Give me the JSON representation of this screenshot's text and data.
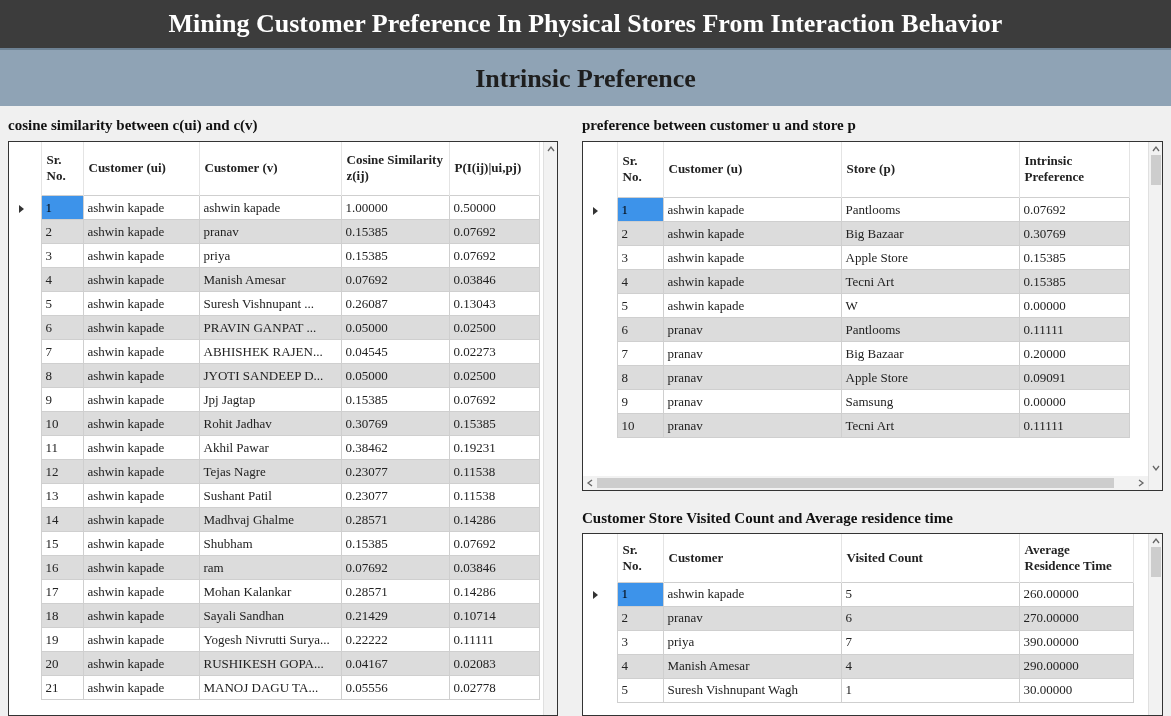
{
  "header": {
    "title": "Mining Customer Preference In Physical Stores From Interaction Behavior"
  },
  "section": {
    "title": "Intrinsic Preference"
  },
  "cosine_panel": {
    "heading": "cosine similarity between c(ui) and c(v)",
    "table": {
      "columns": [
        "Sr. No.",
        "Customer (ui)",
        "Customer (v)",
        "Cosine Similarity z(ij)",
        "P(I(ij)|ui,pj)"
      ],
      "rows": [
        {
          "cells": [
            "1",
            "ashwin kapade",
            "ashwin kapade",
            "1.00000",
            "0.50000"
          ],
          "selected": true
        },
        {
          "cells": [
            "2",
            "ashwin kapade",
            "pranav",
            "0.15385",
            "0.07692"
          ],
          "selected": false
        },
        {
          "cells": [
            "3",
            "ashwin kapade",
            "priya",
            "0.15385",
            "0.07692"
          ],
          "selected": false
        },
        {
          "cells": [
            "4",
            "ashwin kapade",
            "Manish Amesar",
            "0.07692",
            "0.03846"
          ],
          "selected": false
        },
        {
          "cells": [
            "5",
            "ashwin kapade",
            "Suresh Vishnupant  ...",
            "0.26087",
            "0.13043"
          ],
          "selected": false
        },
        {
          "cells": [
            "6",
            "ashwin kapade",
            "PRAVIN GANPAT ...",
            "0.05000",
            "0.02500"
          ],
          "selected": false
        },
        {
          "cells": [
            "7",
            "ashwin kapade",
            "ABHISHEK RAJEN...",
            "0.04545",
            "0.02273"
          ],
          "selected": false
        },
        {
          "cells": [
            "8",
            "ashwin kapade",
            "JYOTI SANDEEP D...",
            "0.05000",
            "0.02500"
          ],
          "selected": false
        },
        {
          "cells": [
            "9",
            "ashwin kapade",
            "Jpj  Jagtap",
            "0.15385",
            "0.07692"
          ],
          "selected": false
        },
        {
          "cells": [
            "10",
            "ashwin kapade",
            "Rohit Jadhav",
            "0.30769",
            "0.15385"
          ],
          "selected": false
        },
        {
          "cells": [
            "11",
            "ashwin kapade",
            "Akhil Pawar",
            "0.38462",
            "0.19231"
          ],
          "selected": false
        },
        {
          "cells": [
            "12",
            "ashwin kapade",
            "Tejas Nagre",
            "0.23077",
            "0.11538"
          ],
          "selected": false
        },
        {
          "cells": [
            "13",
            "ashwin kapade",
            "Sushant Patil",
            "0.23077",
            "0.11538"
          ],
          "selected": false
        },
        {
          "cells": [
            "14",
            "ashwin kapade",
            "Madhvaj Ghalme",
            "0.28571",
            "0.14286"
          ],
          "selected": false
        },
        {
          "cells": [
            "15",
            "ashwin kapade",
            "Shubham",
            "0.15385",
            "0.07692"
          ],
          "selected": false
        },
        {
          "cells": [
            "16",
            "ashwin kapade",
            "ram",
            "0.07692",
            "0.03846"
          ],
          "selected": false
        },
        {
          "cells": [
            "17",
            "ashwin kapade",
            "Mohan Kalankar",
            "0.28571",
            "0.14286"
          ],
          "selected": false
        },
        {
          "cells": [
            "18",
            "ashwin kapade",
            "Sayali Sandhan",
            "0.21429",
            "0.10714"
          ],
          "selected": false
        },
        {
          "cells": [
            "19",
            "ashwin kapade",
            "Yogesh Nivrutti Surya...",
            "0.22222",
            "0.11111"
          ],
          "selected": false
        },
        {
          "cells": [
            "20",
            "ashwin kapade",
            "RUSHIKESH GOPA...",
            "0.04167",
            "0.02083"
          ],
          "selected": false
        },
        {
          "cells": [
            "21",
            "ashwin kapade",
            "MANOJ DAGU TA...",
            "0.05556",
            "0.02778"
          ],
          "selected": false
        }
      ]
    }
  },
  "preference_panel": {
    "heading": "preference between customer u and store p",
    "table": {
      "columns": [
        "Sr. No.",
        "Customer (u)",
        "Store (p)",
        "Intrinsic Preference"
      ],
      "rows": [
        {
          "cells": [
            "1",
            "ashwin kapade",
            "Pantlooms",
            "0.07692"
          ],
          "selected": true
        },
        {
          "cells": [
            "2",
            "ashwin kapade",
            "Big Bazaar",
            "0.30769"
          ],
          "selected": false
        },
        {
          "cells": [
            "3",
            "ashwin kapade",
            "Apple Store",
            "0.15385"
          ],
          "selected": false
        },
        {
          "cells": [
            "4",
            "ashwin kapade",
            "Tecni Art",
            "0.15385"
          ],
          "selected": false
        },
        {
          "cells": [
            "5",
            "ashwin kapade",
            "W",
            "0.00000"
          ],
          "selected": false
        },
        {
          "cells": [
            "6",
            "pranav",
            "Pantlooms",
            "0.11111"
          ],
          "selected": false
        },
        {
          "cells": [
            "7",
            "pranav",
            "Big Bazaar",
            "0.20000"
          ],
          "selected": false
        },
        {
          "cells": [
            "8",
            "pranav",
            "Apple Store",
            "0.09091"
          ],
          "selected": false
        },
        {
          "cells": [
            "9",
            "pranav",
            "Samsung",
            "0.00000"
          ],
          "selected": false
        },
        {
          "cells": [
            "10",
            "pranav",
            "Tecni Art",
            "0.11111"
          ],
          "selected": false
        }
      ]
    }
  },
  "visits_panel": {
    "heading": "Customer Store Visited Count and Average residence time",
    "table": {
      "columns": [
        "Sr. No.",
        "Customer",
        "Visited Count",
        "Average Residence Time"
      ],
      "rows": [
        {
          "cells": [
            "1",
            "ashwin kapade",
            "5",
            "260.00000"
          ],
          "selected": true
        },
        {
          "cells": [
            "2",
            "pranav",
            "6",
            "270.00000"
          ],
          "selected": false
        },
        {
          "cells": [
            "3",
            "priya",
            "7",
            "390.00000"
          ],
          "selected": false
        },
        {
          "cells": [
            "4",
            "Manish Amesar",
            "4",
            "290.00000"
          ],
          "selected": false
        },
        {
          "cells": [
            "5",
            "Suresh Vishnupant  Wagh",
            "1",
            "30.00000"
          ],
          "selected": false
        }
      ]
    }
  }
}
